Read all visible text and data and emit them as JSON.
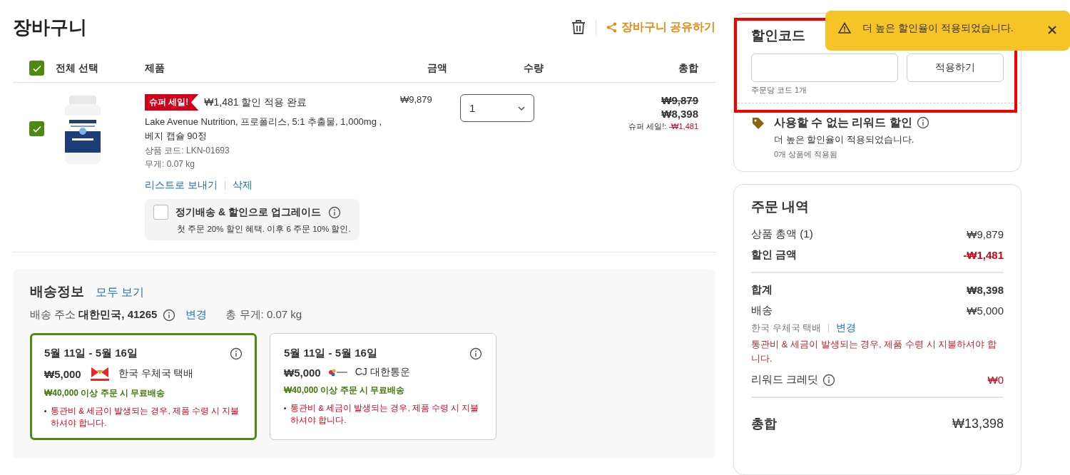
{
  "cart": {
    "title": "장바구니",
    "share": "장바구니 공유하기",
    "header": {
      "select_all": {
        "label": "전체 선택",
        "checked": true
      },
      "columns": [
        "제품",
        "금액",
        "수량",
        "총합"
      ]
    },
    "items": [
      {
        "checked": true,
        "badge": "슈퍼 세일!",
        "discount_note": "₩1,481 할인 적용 완료",
        "name": "Lake Avenue Nutrition, 프로폴리스, 5:1 추출물, 1,000mg , 베지 캡슐 90정",
        "code": "상품 코드: LKN-01693",
        "weight": "무게: 0.07 kg",
        "price": "₩9,879",
        "quantity": "1",
        "original_total": "₩9,879",
        "total": "₩8,398",
        "sale_label": "슈퍼 세일!:",
        "sale_amount": "-₩1,481",
        "actions": [
          "리스트로 보내기",
          "삭제"
        ],
        "subscribe": {
          "checked": false,
          "label": "정기배송 & 할인으로 업그레이드",
          "note": "첫 주문 20% 할인 혜택. 이후 6 주문 10% 할인."
        }
      }
    ]
  },
  "shipping": {
    "title": "배송정보",
    "view_all": "모두 보기",
    "address_label": "배송 주소",
    "address": "대한민국, 41265",
    "change": "변경",
    "weight": "총 무게: 0.07 kg",
    "options": [
      {
        "selected": true,
        "dates": "5월 11일 - 5월 16일",
        "price": "₩5,000",
        "carrier": "한국 우체국 택배",
        "kind": "post",
        "free_note": "₩40,000 이상 주문 시 무료배송",
        "notice": "통관비 & 세금이 발생되는 경우, 제품 수령 시 지불하셔야 합니다."
      },
      {
        "selected": false,
        "dates": "5월 11일 - 5월 16일",
        "price": "₩5,000",
        "carrier": "CJ 대한통운",
        "kind": "cj",
        "free_note": "₩40,000 이상 주문 시 무료배송",
        "notice": "통관비 & 세금이 발생되는 경우, 제품 수령 시 지불하셔야 합니다."
      }
    ]
  },
  "coupon": {
    "title": "할인코드",
    "apply": "적용하기",
    "hint": "주문당 코드 1개",
    "reward": {
      "title": "사용할 수 없는 리워드 할인",
      "message": "더 높은 할인율이 적용되었습니다.",
      "applied": "0개 상품에 적용됨"
    }
  },
  "summary": {
    "title": "주문 내역",
    "rows": [
      {
        "kind": "line",
        "label": "상품 총액 (1)",
        "value": "₩9,879"
      },
      {
        "kind": "discount",
        "label": "할인 금액",
        "value": "-₩1,481"
      },
      {
        "kind": "divider"
      },
      {
        "kind": "subtotal",
        "label": "합계",
        "value": "₩8,398"
      },
      {
        "kind": "line",
        "label": "배송",
        "value": "₩5,000"
      },
      {
        "kind": "carrier",
        "label": "한국 우체국 택배",
        "link": "변경"
      },
      {
        "kind": "notice",
        "label": "통관비 & 세금이 발생되는 경우, 제품 수령 시 지불하셔야 합니다."
      },
      {
        "kind": "credit",
        "label": "리워드 크레딧",
        "value": "₩0"
      },
      {
        "kind": "divider"
      },
      {
        "kind": "total",
        "label": "총합",
        "value": "₩13,398"
      }
    ]
  },
  "toast": {
    "message": "더 높은 할인율이 적용되었습니다."
  }
}
